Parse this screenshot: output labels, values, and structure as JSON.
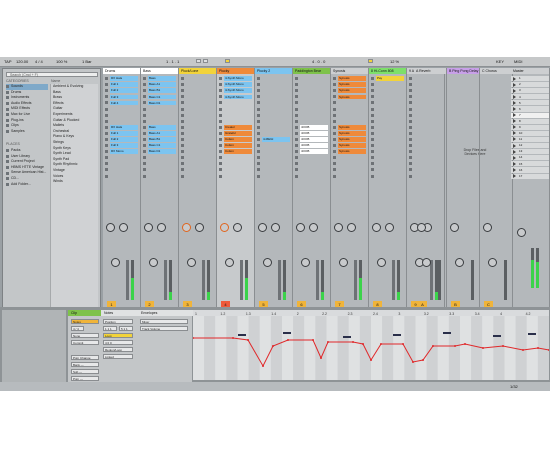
{
  "transport": {
    "tap": "TAP",
    "tempo": "120.00",
    "meter": "4 / 4",
    "zoom": "100 %",
    "bar": "1 Bar",
    "position": "1 . 1 . 1",
    "loop_len": "4 . 0 . 0",
    "key": "KEY",
    "cpu": "12 %",
    "midi": "MIDI"
  },
  "browser": {
    "search_placeholder": "Search (Cmd + F)",
    "categories_header": "CATEGORIES",
    "name_header": "Name",
    "categories": [
      "Sounds",
      "Drums",
      "Instruments",
      "Audio Effects",
      "MIDI Effects",
      "Max for Live",
      "Plug-ins",
      "Clips",
      "Samples"
    ],
    "places_header": "PLACES",
    "places": [
      "Packs",
      "User Library",
      "Current Project",
      "HBMS HTTE Vintage",
      "Sense American Hist...",
      "CD...",
      "Add Folder..."
    ],
    "names": [
      "Ambient & Evolving",
      "Bass",
      "Brass",
      "Effects",
      "Guitar",
      "Experiments",
      "Guitar & Plucked",
      "Mallets",
      "Orchestral",
      "Piano & Keys",
      "Strings",
      "Synth Keys",
      "Synth Lead",
      "Synth Pad",
      "Synth Rhythmic",
      "Vintage",
      "Voices",
      "Winds"
    ]
  },
  "tracks": [
    {
      "name": "Drums",
      "color": "#ffffff",
      "num": "1",
      "clips": [
        "RX Hats",
        "Full 1",
        "Full 2",
        "Full 3",
        "Full 4",
        "",
        "",
        "",
        "RX Hats",
        "Full 1",
        "Full 2",
        "Full 3",
        "RX Mono"
      ]
    },
    {
      "name": "Bass",
      "color": "#ffffff",
      "num": "2",
      "clips": [
        "Bass",
        "Bass A1",
        "Bass B1",
        "Bass C1",
        "Bass D1",
        "",
        "",
        "",
        "Bass",
        "Bass A1",
        "Bass B1",
        "Bass C1",
        "Bass D1"
      ]
    },
    {
      "name": "Pluck/Lone",
      "color": "#f2d33a",
      "num": "3",
      "clips": [
        "",
        "",
        "",
        "",
        "",
        "",
        "",
        "",
        "",
        "",
        "",
        "",
        ""
      ]
    },
    {
      "name": "Plucky",
      "color": "#ef8a3a",
      "num": "4",
      "clips": [
        "4-Synth Mono",
        "4-Synth Mono",
        "4-Synth Mono",
        "4-Synth Mono",
        "",
        "",
        "",
        "",
        "Creator",
        "Grateful",
        "Cotton",
        "Cotton",
        "Cotton"
      ]
    },
    {
      "name": "Plucky 2",
      "color": "#7cc4f0",
      "num": "5",
      "clips": [
        "",
        "",
        "",
        "",
        "",
        "",
        "",
        "",
        "",
        "",
        "4-MEGI",
        "",
        ""
      ]
    },
    {
      "name": "Paddington Bear",
      "color": "#7ec24a",
      "num": "6",
      "clips": [
        "",
        "",
        "",
        "",
        "",
        "",
        "",
        "",
        "4OOB",
        "4OOB",
        "4OOB",
        "4OOB",
        "4OOB"
      ]
    },
    {
      "name": "Synosis",
      "color": "#cdcfd1",
      "num": "7",
      "clips": [
        "Synosis",
        "Synosis",
        "Synosis",
        "Synosis",
        "",
        "",
        "",
        "",
        "Synosis",
        "Synosis",
        "Synosis",
        "Synosis",
        "Synosis"
      ]
    },
    {
      "name": "8 Hi-Conn 808",
      "color": "#7ee06a",
      "num": "8",
      "clips": [
        "Pay",
        "",
        "",
        "",
        "",
        "",
        "",
        "",
        "",
        "",
        "",
        "",
        ""
      ]
    },
    {
      "name": "9 Audio",
      "color": "#cdcfd1",
      "num": "9",
      "clips": [
        "",
        "",
        "",
        "",
        "",
        "",
        "",
        "",
        "",
        "",
        "",
        "",
        ""
      ]
    }
  ],
  "drop_text": "Drop Files and Devices Here",
  "returns": [
    {
      "name": "A Reverb",
      "color": "#cdcfd1",
      "label": "A"
    },
    {
      "name": "B Ping Pong Delay",
      "color": "#c8a0e8",
      "label": "B"
    },
    {
      "name": "C Chorus",
      "color": "#cdcfd1",
      "label": "C"
    }
  ],
  "master": {
    "name": "Master",
    "scenes": [
      "1",
      "2",
      "3",
      "4",
      "5",
      "6",
      "7",
      "8",
      "9",
      "10",
      "11",
      "12",
      "13",
      "14",
      "15",
      "16",
      "17"
    ]
  },
  "clip_view": {
    "clip_label": "Clip",
    "clip_name": "Notes",
    "envelopes_label": "Envelopes",
    "signature": "4 / 4",
    "groove": "None",
    "commit": "Commit",
    "start": "1 1 1",
    "end": "5 1 1",
    "length": "4 0 0",
    "pgm_change": "Pgm Change",
    "mixer": "Mixer",
    "track_volume": "Track Volume",
    "bank": "Bank ---",
    "sub": "Sub ---",
    "pgm": "Pgm ---",
    "pos": "Position",
    "region": "Region/Loop",
    "linked": "Linked",
    "loop": "Loop"
  },
  "envelope": {
    "bar_labels": [
      "1",
      "1.2",
      "1.3",
      "1.4",
      "2",
      "2.2",
      "2.3",
      "2.4",
      "3",
      "3.2",
      "3.3",
      "3.4",
      "4",
      "4.2"
    ],
    "zoom_label": "1/32"
  },
  "colors": {
    "accent_orange": "#f0b43a",
    "solo_blue": "#3b8fd4",
    "meter_green": "#3bd34a",
    "envelope_red": "#e0282a"
  }
}
